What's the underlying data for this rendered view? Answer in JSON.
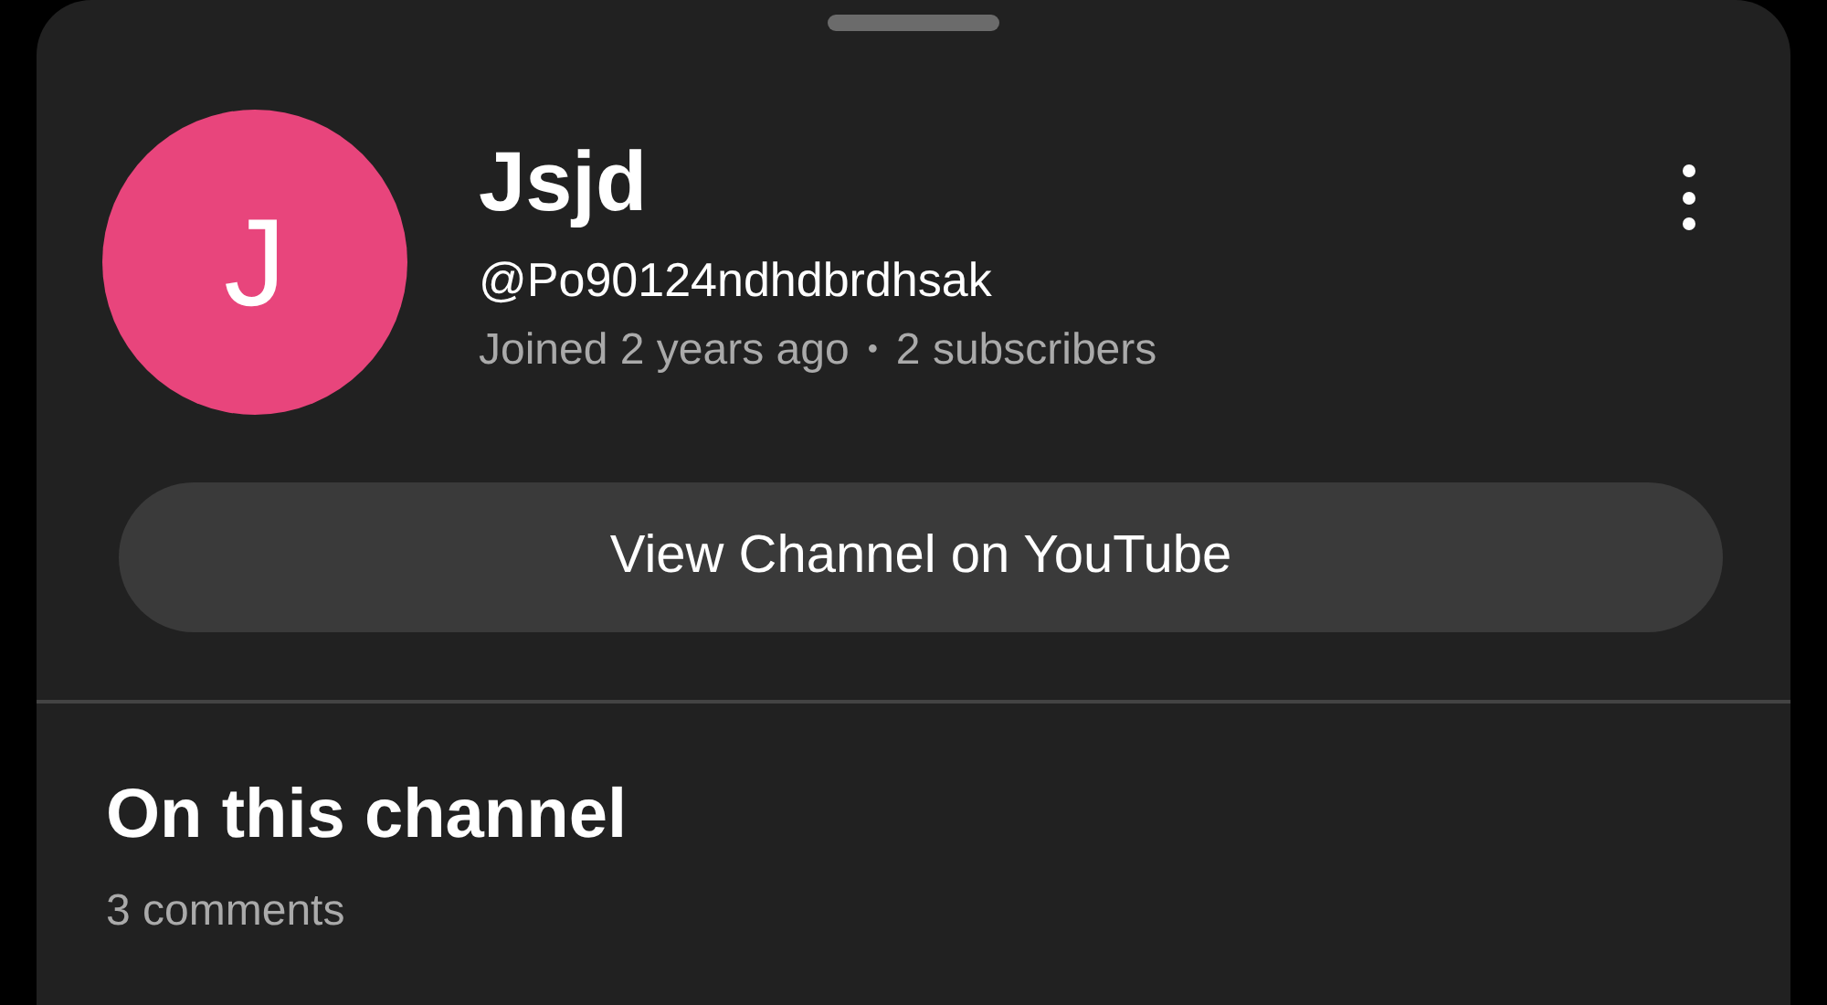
{
  "channel": {
    "avatar": {
      "initial": "J",
      "color": "#e8457c"
    },
    "name": "Jsjd",
    "handle": "@Po90124ndhdbrdhsak",
    "joined": "Joined 2 years ago",
    "separator": "•",
    "subscribers": "2 subscribers"
  },
  "view_button": "View Channel on YouTube",
  "section": {
    "title": "On this channel",
    "count": "3 comments"
  }
}
